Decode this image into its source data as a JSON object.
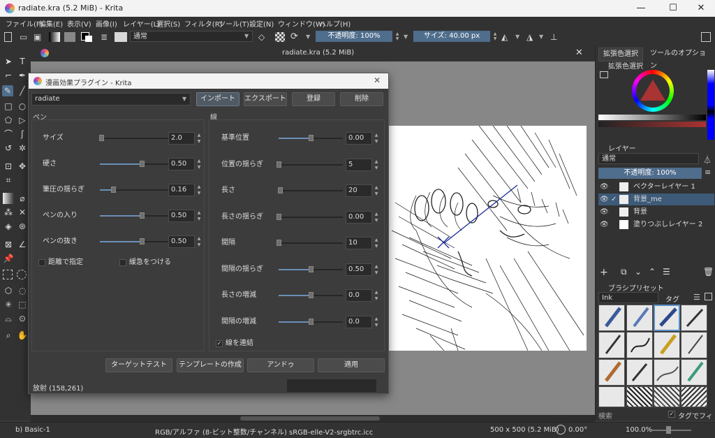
{
  "window": {
    "title": "radiate.kra (5.2 MiB)  - Krita",
    "minimize_icon": "—",
    "maximize_icon": "☐",
    "close_icon": "✕"
  },
  "menu": [
    "ファイル(F)",
    "編集(E)",
    "表示(V)",
    "画像(I)",
    "レイヤー(L)",
    "選択(S)",
    "フィルタ(R)",
    "ツール(T)",
    "設定(N)",
    "ウィンドウ(W)",
    "ヘルプ(H)"
  ],
  "toolbar": {
    "blend_mode": "通常",
    "opacity": "不透明度: 100%",
    "size": "サイズ: 40.00 px"
  },
  "canvas": {
    "tab_title": "radiate.kra (5.2 MiB)",
    "close_icon": "✕"
  },
  "dock": {
    "tabs": [
      "拡張色選択",
      "ツールのオプション"
    ],
    "color_selector_title": "拡張色選択",
    "layers_title": "レイヤー",
    "layer_blend": "通常",
    "layer_opacity": "不透明度: 100%",
    "layers": [
      {
        "name": "ベクターレイヤー 1"
      },
      {
        "name": "背景_me"
      },
      {
        "name": "背景"
      },
      {
        "name": "塗りつぶしレイヤー 2"
      }
    ],
    "brush_title": "ブラシプリセット",
    "brush_tag": "Ink",
    "tag_label": "タグ",
    "search_placeholder": "検索",
    "tag_filter": "タグでフィルタ"
  },
  "status": {
    "brush": "b) Basic-1",
    "color_space": "RGB/アルファ (8-ビット整数/チャンネル)  sRGB-elle-V2-srgbtrc.icc",
    "image_size": "500 x 500 (5.2 MiB)",
    "rotation": "0.00°",
    "zoom": "100.0%"
  },
  "dialog": {
    "title": "漫画効果プラグイン - Krita",
    "close_icon": "✕",
    "preset": "radiate",
    "buttons": {
      "import": "インポート",
      "export": "エクスポート",
      "register": "登録",
      "delete": "削除"
    },
    "pen_group": "ペン",
    "line_group": "線",
    "pen_params": [
      {
        "label": "サイズ",
        "value": "2.0",
        "fraction": 0.02
      },
      {
        "label": "硬さ",
        "value": "0.50",
        "fraction": 0.5
      },
      {
        "label": "筆圧の揺らぎ",
        "value": "0.16",
        "fraction": 0.16
      },
      {
        "label": "ペンの入り",
        "value": "0.50",
        "fraction": 0.5
      },
      {
        "label": "ペンの抜き",
        "value": "0.50",
        "fraction": 0.5
      }
    ],
    "pen_checks": [
      "距離で指定",
      "緩急をつける"
    ],
    "line_params": [
      {
        "label": "基準位置",
        "value": "0.00",
        "fraction": 0.5
      },
      {
        "label": "位置の揺らぎ",
        "value": "5",
        "fraction": 0.0
      },
      {
        "label": "長さ",
        "value": "20",
        "fraction": 0.02
      },
      {
        "label": "長さの揺らぎ",
        "value": "0.00",
        "fraction": 0.0
      },
      {
        "label": "間隔",
        "value": "10",
        "fraction": 0.0
      },
      {
        "label": "間隔の揺らぎ",
        "value": "0.50",
        "fraction": 0.5
      },
      {
        "label": "長さの増減",
        "value": "0.0",
        "fraction": 0.5
      },
      {
        "label": "間隔の増減",
        "value": "0.0",
        "fraction": 0.5
      }
    ],
    "connect_lines": "線を連結",
    "bottom_buttons": {
      "target_test": "ターゲットテスト",
      "create_template": "テンプレートの作成",
      "undo": "アンドゥ",
      "apply": "適用"
    },
    "status": "放射 (158,261)"
  },
  "colors": {
    "accent": "#4f6d8c",
    "selection": "#3d5a78"
  }
}
